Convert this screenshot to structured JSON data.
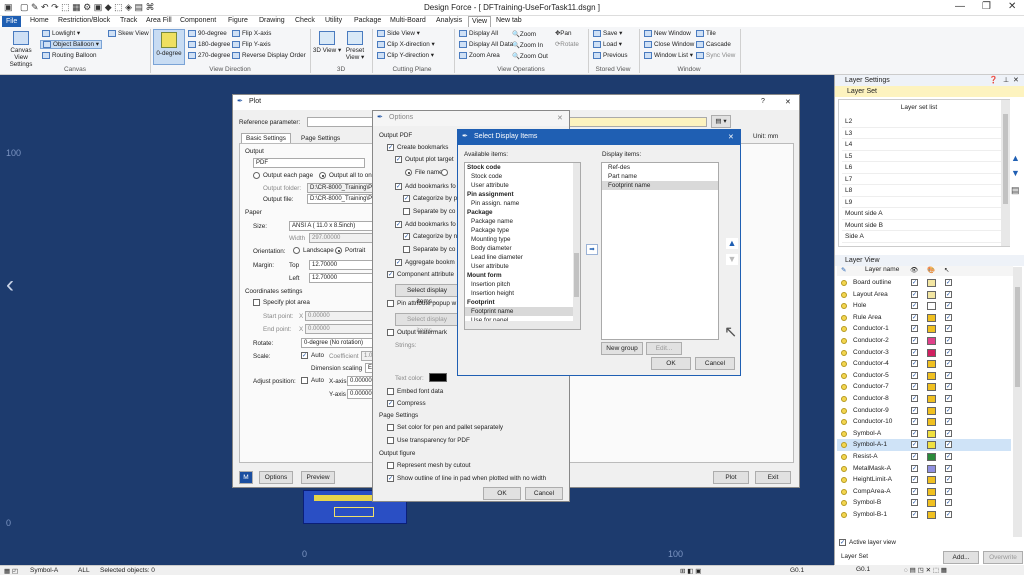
{
  "app": {
    "title": "Design Force - [ DFTraining-UseForTask11.dsgn ]"
  },
  "menu": [
    "File",
    "Home",
    "Restriction/Block",
    "Track",
    "Area Fill",
    "Component",
    "Figure",
    "Drawing",
    "Check",
    "Utility",
    "Package",
    "Multi-Board",
    "Analysis",
    "View",
    "New tab"
  ],
  "ribbon": {
    "canvas": {
      "canvas_view_settings": "Canvas View Settings",
      "lowlight": "Lowlight",
      "object_balloon": "Object Balloon",
      "routing_balloon": "Routing Balloon",
      "skew_view": "Skew View",
      "group": "Canvas"
    },
    "view_direction": {
      "deg0": "0-degree",
      "deg90": "90-degree",
      "deg180": "180-degree",
      "deg270": "270-degree",
      "flipx": "Flip X-axis",
      "flipy": "Flip Y-axis",
      "reverse": "Reverse Display Order",
      "group": "View Direction"
    },
    "d3": {
      "view3d": "3D View",
      "preset": "Preset View",
      "group": "3D"
    },
    "cutting": {
      "side": "Side View",
      "clipx": "Clip X-direction",
      "clipy": "Clip Y-direction",
      "group": "Cutting Plane"
    },
    "ops": {
      "display_all": "Display All",
      "display_all_data": "Display All Data",
      "zoom_area": "Zoom Area",
      "zoom": "Zoom",
      "zoom_in": "Zoom In",
      "zoom_out": "Zoom Out",
      "pan": "Pan",
      "rotate": "Rotate",
      "group": "View Operations"
    },
    "stored": {
      "save": "Save",
      "load": "Load",
      "previous": "Previous",
      "group": "Stored View"
    },
    "window": {
      "new_window": "New Window",
      "close_window": "Close Window",
      "window_list": "Window List",
      "tile": "Tile",
      "cascade": "Cascade",
      "sync_view": "Sync View",
      "group": "Window"
    }
  },
  "canvas": {
    "axis_100_left": "100",
    "axis_0_left": "0",
    "axis_0_bottom": "0",
    "axis_100_bottom": "100"
  },
  "plot": {
    "title": "Plot",
    "ref_param": "Reference parameter:",
    "tab_basic": "Basic Settings",
    "tab_page": "Page Settings",
    "unit": "Unit: mm",
    "output": "Output",
    "format": "PDF",
    "each_page": "Output each page",
    "all_to_one": "Output all to on",
    "folder_label": "Output folder:",
    "folder": "D:\\CR-8000_Training\\P",
    "file_label": "Output file:",
    "file": "D:\\CR-8000_Training\\P",
    "paper": "Paper",
    "size_label": "Size:",
    "size": "ANSI A ( 11.0 x 8.5inch)",
    "width_label": "Width",
    "width": "297.00000",
    "orientation_label": "Orientation:",
    "landscape": "Landscape",
    "portrait": "Portrait",
    "margin_label": "Margin:",
    "top_label": "Top",
    "top": "12.70000",
    "left_label": "Left",
    "left": "12.70000",
    "coords": "Coordinates settings",
    "specify_area": "Specify plot area",
    "start_label": "Start point:",
    "end_label": "End point:",
    "x_label": "X",
    "xval": "0.00000",
    "rotate_label": "Rotate:",
    "rotate": "0-degree (No rotation)",
    "scale_label": "Scale:",
    "auto": "Auto",
    "coeff": "Coefficient",
    "coeff_val": "1.0",
    "dim_scaling": "Dimension scaling",
    "dim_val": "En",
    "adjust_label": "Adjust position:",
    "xaxis": "X-axis",
    "yaxis": "Y-axis",
    "axis_val": "0.00000",
    "options_btn": "Options",
    "preview_btn": "Preview",
    "plot_btn": "Plot",
    "exit_btn": "Exit"
  },
  "options": {
    "title": "Options",
    "output_pdf": "Output PDF",
    "create_bookmarks": "Create bookmarks",
    "output_plot_target": "Output plot target",
    "file_name": "File name",
    "add_bookmarks_1": "Add bookmarks fo",
    "categorize_1": "Categorize by p",
    "separate_1": "Separate by co",
    "add_bookmarks_2": "Add bookmarks fo",
    "categorize_2": "Categorize by n",
    "separate_2": "Separate by co",
    "aggregate": "Aggregate bookm",
    "component_attr": "Component attribute",
    "select_items_1": "Select display items...",
    "pin_popup": "Pin attribute popup w",
    "select_items_2": "Select display items...",
    "output_watermark": "Output watermark",
    "strings": "Strings:",
    "text_color": "Text color:",
    "embed_font": "Embed font data",
    "compress": "Compress",
    "page_settings": "Page Settings",
    "set_color": "Set color for pen and pallet separately",
    "use_transparency": "Use transparency for PDF",
    "output_figure": "Output figure",
    "represent_mesh": "Represent mesh by cutout",
    "show_outline": "Show outline of line in pad when plotted with no width",
    "ok": "OK",
    "cancel": "Cancel"
  },
  "select_items": {
    "title": "Select Display Items",
    "available_label": "Available items:",
    "display_label": "Display items:",
    "available": [
      {
        "t": "Stock code",
        "h": true
      },
      {
        "t": "Stock code"
      },
      {
        "t": "User attribute"
      },
      {
        "t": "Pin assignment",
        "h": true
      },
      {
        "t": "Pin assign. name"
      },
      {
        "t": "Package",
        "h": true
      },
      {
        "t": "Package name"
      },
      {
        "t": "Package type"
      },
      {
        "t": "Mounting type"
      },
      {
        "t": "Body diameter"
      },
      {
        "t": "Lead line diameter"
      },
      {
        "t": "User attribute"
      },
      {
        "t": "Mount form",
        "h": true
      },
      {
        "t": "Insertion pitch"
      },
      {
        "t": "Insertion height"
      },
      {
        "t": "Footprint",
        "h": true
      },
      {
        "t": "Footprint name",
        "s": true
      },
      {
        "t": "Use for panel"
      }
    ],
    "display": [
      {
        "t": "Ref-des"
      },
      {
        "t": "Part name"
      },
      {
        "t": "Footprint name",
        "s": true
      }
    ],
    "new_group": "New group",
    "edit": "Edit...",
    "ok": "OK",
    "cancel": "Cancel"
  },
  "layer_settings": {
    "title": "Layer Settings",
    "tab": "Layer Set",
    "list_header": "Layer set list",
    "items": [
      "L2",
      "L3",
      "L4",
      "L5",
      "L6",
      "L7",
      "L8",
      "L9",
      "Mount side A",
      "Mount side B",
      "Side A"
    ]
  },
  "layer_view": {
    "title": "Layer View",
    "col_name": "Layer name",
    "rows": [
      {
        "n": "Board outline",
        "c": "#f3e6a2",
        "v": true,
        "s": true
      },
      {
        "n": "Layout Area",
        "c": "#f3e6a2",
        "v": true,
        "s": true
      },
      {
        "n": "Hole",
        "c": "#ffffff",
        "v": true,
        "s": true
      },
      {
        "n": "Rule Area",
        "c": "#f0c020",
        "v": true,
        "s": true
      },
      {
        "n": "Conductor-1",
        "c": "#f0c020",
        "v": true,
        "s": true
      },
      {
        "n": "Conductor-2",
        "c": "#e0408a",
        "v": true,
        "s": true
      },
      {
        "n": "Conductor-3",
        "c": "#d02060",
        "v": true,
        "s": true
      },
      {
        "n": "Conductor-4",
        "c": "#f0c020",
        "v": true,
        "s": true
      },
      {
        "n": "Conductor-5",
        "c": "#f0c020",
        "v": true,
        "s": true
      },
      {
        "n": "Conductor-7",
        "c": "#f0c020",
        "v": true,
        "s": true
      },
      {
        "n": "Conductor-8",
        "c": "#f0c020",
        "v": true,
        "s": true
      },
      {
        "n": "Conductor-9",
        "c": "#f0c020",
        "v": true,
        "s": true
      },
      {
        "n": "Conductor-10",
        "c": "#f0c020",
        "v": true,
        "s": true
      },
      {
        "n": "Symbol-A",
        "c": "#f0e040",
        "v": true,
        "s": true
      },
      {
        "n": "Symbol-A-1",
        "c": "#f0e040",
        "v": true,
        "s": true
      },
      {
        "n": "Resist-A",
        "c": "#2a8a3a",
        "v": true,
        "s": true
      },
      {
        "n": "MetalMask-A",
        "c": "#9090e0",
        "v": true,
        "s": true
      },
      {
        "n": "HeightLimit-A",
        "c": "#f0c020",
        "v": true,
        "s": true
      },
      {
        "n": "CompArea-A",
        "c": "#f0c020",
        "v": true,
        "s": true
      },
      {
        "n": "Symbol-B",
        "c": "#f0c020",
        "v": true,
        "s": true
      },
      {
        "n": "Symbol-B-1",
        "c": "#f0c020",
        "v": true,
        "s": true
      }
    ],
    "active_layer_view": "Active layer view",
    "layer_set": "Layer Set",
    "add": "Add...",
    "overwrite": "Overwrite"
  },
  "status": {
    "layer": "Symbol-A",
    "filter": "ALL",
    "selected": "Selected objects: 0",
    "grid1": "G0.1",
    "grid2": "G0.1"
  }
}
